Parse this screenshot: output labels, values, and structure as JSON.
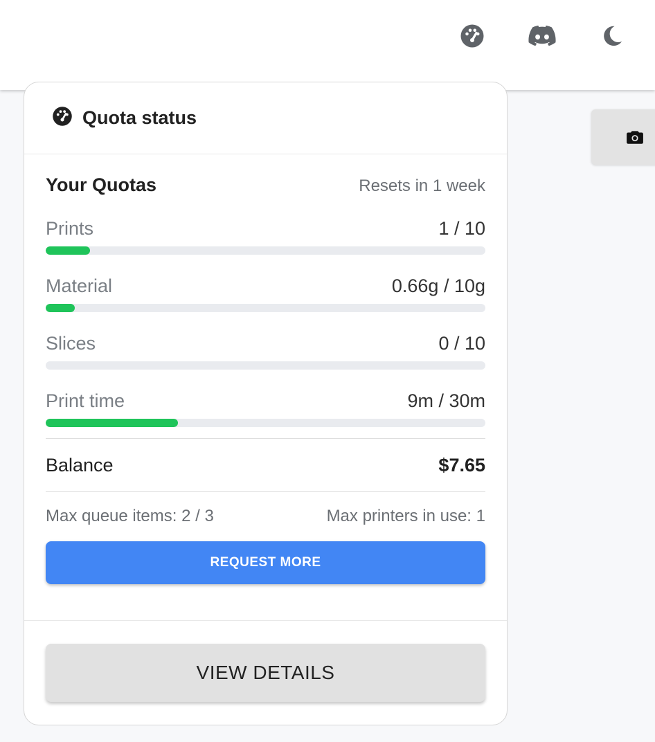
{
  "topbar": {
    "icons": [
      "speedometer-icon",
      "discord-icon",
      "moon-icon"
    ]
  },
  "side_tab": {
    "icon": "camera-icon"
  },
  "card": {
    "title": "Quota status",
    "title_icon": "speedometer-icon",
    "section_title": "Your Quotas",
    "reset_text": "Resets in 1 week",
    "quotas": [
      {
        "label": "Prints",
        "value": "1 / 10",
        "fraction": 0.1
      },
      {
        "label": "Material",
        "value": "0.66g / 10g",
        "fraction": 0.066
      },
      {
        "label": "Slices",
        "value": "0 / 10",
        "fraction": 0
      },
      {
        "label": "Print time",
        "value": "9m / 30m",
        "fraction": 0.3
      }
    ],
    "balance_label": "Balance",
    "balance_value": "$7.65",
    "max_queue": "Max queue items: 2 / 3",
    "max_printers": "Max printers in use: 1",
    "request_button": "REQUEST MORE",
    "details_button": "VIEW DETAILS"
  },
  "colors": {
    "accent": "#4286f4",
    "progress": "#1fc45a",
    "track": "#e9ebef"
  }
}
